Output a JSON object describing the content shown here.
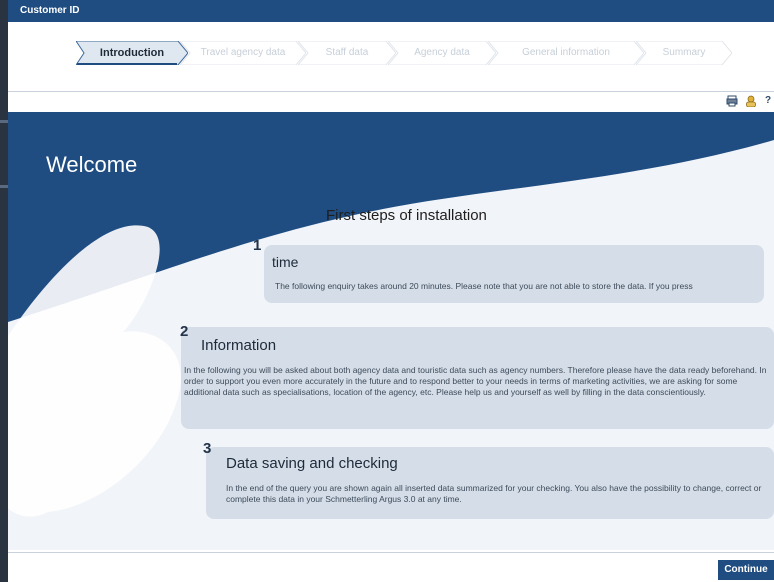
{
  "window": {
    "title": "Customer ID"
  },
  "wizard": {
    "steps": [
      {
        "label": "Introduction",
        "active": true
      },
      {
        "label": "Travel agency data",
        "active": false
      },
      {
        "label": "Staff data",
        "active": false
      },
      {
        "label": "Agency data",
        "active": false
      },
      {
        "label": "General information",
        "active": false
      },
      {
        "label": "Summary",
        "active": false
      }
    ]
  },
  "toolbar": {
    "icons": [
      "print-icon",
      "contact-icon",
      "help-icon"
    ]
  },
  "main": {
    "heading": "Welcome",
    "subheading": "First steps of installation",
    "sections": [
      {
        "number": "1",
        "title": "time",
        "text": "The following enquiry takes around 20 minutes. Please note that you are not able to store the data. If you press"
      },
      {
        "number": "2",
        "title": "Information",
        "text": "In the following you will be asked about both agency data and touristic data such as agency numbers. Therefore please have the data ready beforehand. In order to support you even more accurately in the future and to respond better to your needs in terms of marketing activities, we are asking for some additional data such as specialisations, location of the agency, etc. Please help us and yourself as well by filling in the data conscientiously."
      },
      {
        "number": "3",
        "title": "Data saving and checking",
        "text": "In the end of the query you are shown again all inserted data summarized for your checking. You also have the possibility to change, correct or complete this data in your Schmetterling Argus 3.0 at any time."
      }
    ]
  },
  "footer": {
    "continue_label": "Continue"
  },
  "colors": {
    "primary": "#1f4d82",
    "card": "#d5dee8",
    "background": "#f1f4f8"
  }
}
